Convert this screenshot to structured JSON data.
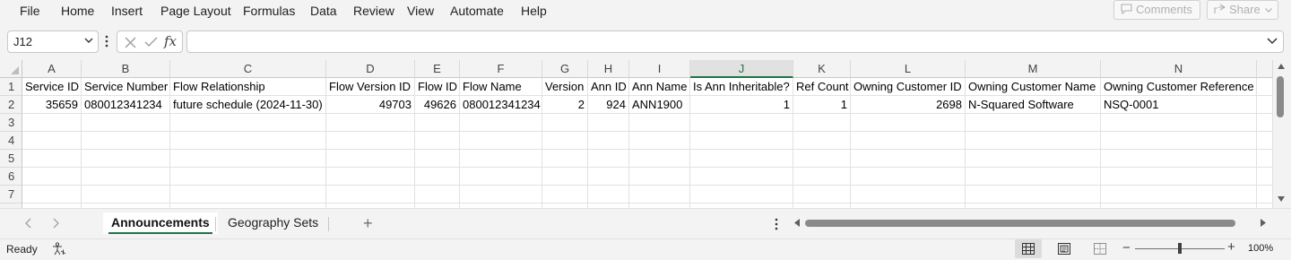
{
  "menu": [
    "File",
    "Home",
    "Insert",
    "Page Layout",
    "Formulas",
    "Data",
    "Review",
    "View",
    "Automate",
    "Help"
  ],
  "topbuttons": {
    "comments_label": "Comments",
    "share_label": "Share"
  },
  "formula_bar": {
    "name_box": "J12",
    "fx_symbol": "fx",
    "formula_value": ""
  },
  "sheet": {
    "column_letters": [
      "A",
      "B",
      "C",
      "D",
      "E",
      "F",
      "G",
      "H",
      "I",
      "J",
      "K",
      "L",
      "M",
      "N"
    ],
    "selected_column": "J",
    "row_numbers": [
      "1",
      "2",
      "3",
      "4",
      "5",
      "6",
      "7"
    ],
    "headers": [
      "Service ID",
      "Service Number",
      "Flow Relationship",
      "Flow Version ID",
      "Flow ID",
      "Flow Name",
      "Version",
      "Ann ID",
      "Ann Name",
      "Is Ann Inheritable?",
      "Ref Count",
      "Owning Customer ID",
      "Owning Customer Name",
      "Owning Customer Reference"
    ],
    "row2": [
      "35659",
      "080012341234",
      "future schedule (2024-11-30)",
      "49703",
      "49626",
      "080012341234",
      "2",
      "924",
      "ANN1900",
      "1",
      "1",
      "2698",
      "N-Squared Software",
      "NSQ-0001"
    ]
  },
  "tabs": {
    "sheets": [
      "Announcements",
      "Geography Sets"
    ],
    "active": "Announcements"
  },
  "status": {
    "ready_label": "Ready",
    "zoom_level": "100%"
  },
  "colors": {
    "accent": "#217346"
  }
}
